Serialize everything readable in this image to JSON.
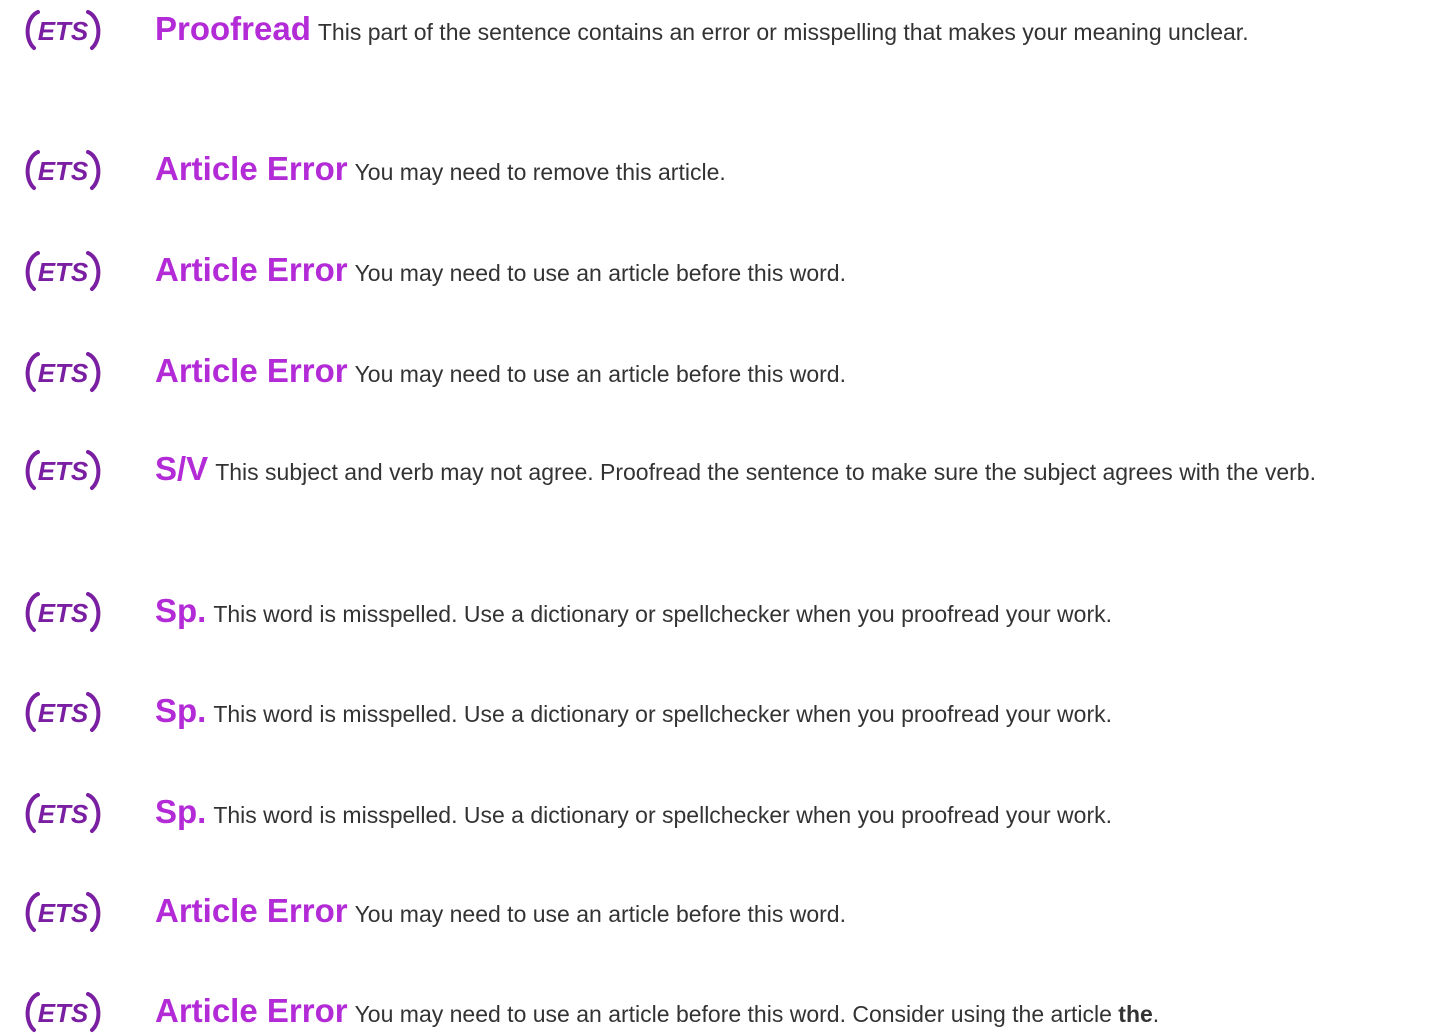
{
  "brand": {
    "logo_text": "ETS",
    "logo_color": "#7a1fa2",
    "accent_color": "#b32bd6",
    "text_color": "#333333"
  },
  "items": [
    {
      "title": "Proofread",
      "message": "This part of the sentence contains an error or misspelling that makes your meaning unclear."
    },
    {
      "title": "Article Error",
      "message": "You may need to remove this article."
    },
    {
      "title": "Article Error",
      "message": "You may need to use an article before this word."
    },
    {
      "title": "Article Error",
      "message": "You may need to use an article before this word."
    },
    {
      "title": "S/V",
      "message": "This subject and verb may not agree. Proofread the sentence to make sure the subject agrees with the verb."
    },
    {
      "title": "Sp.",
      "message": "This word is misspelled. Use a dictionary or spellchecker when you proofread your work."
    },
    {
      "title": "Sp.",
      "message": "This word is misspelled. Use a dictionary or spellchecker when you proofread your work."
    },
    {
      "title": "Sp.",
      "message": "This word is misspelled. Use a dictionary or spellchecker when you proofread your work."
    },
    {
      "title": "Article Error",
      "message": "You may need to use an article before this word."
    },
    {
      "title": "Article Error",
      "message": "You may need to use an article before this word. Consider using the article",
      "emphasis": "the",
      "suffix": "."
    }
  ]
}
